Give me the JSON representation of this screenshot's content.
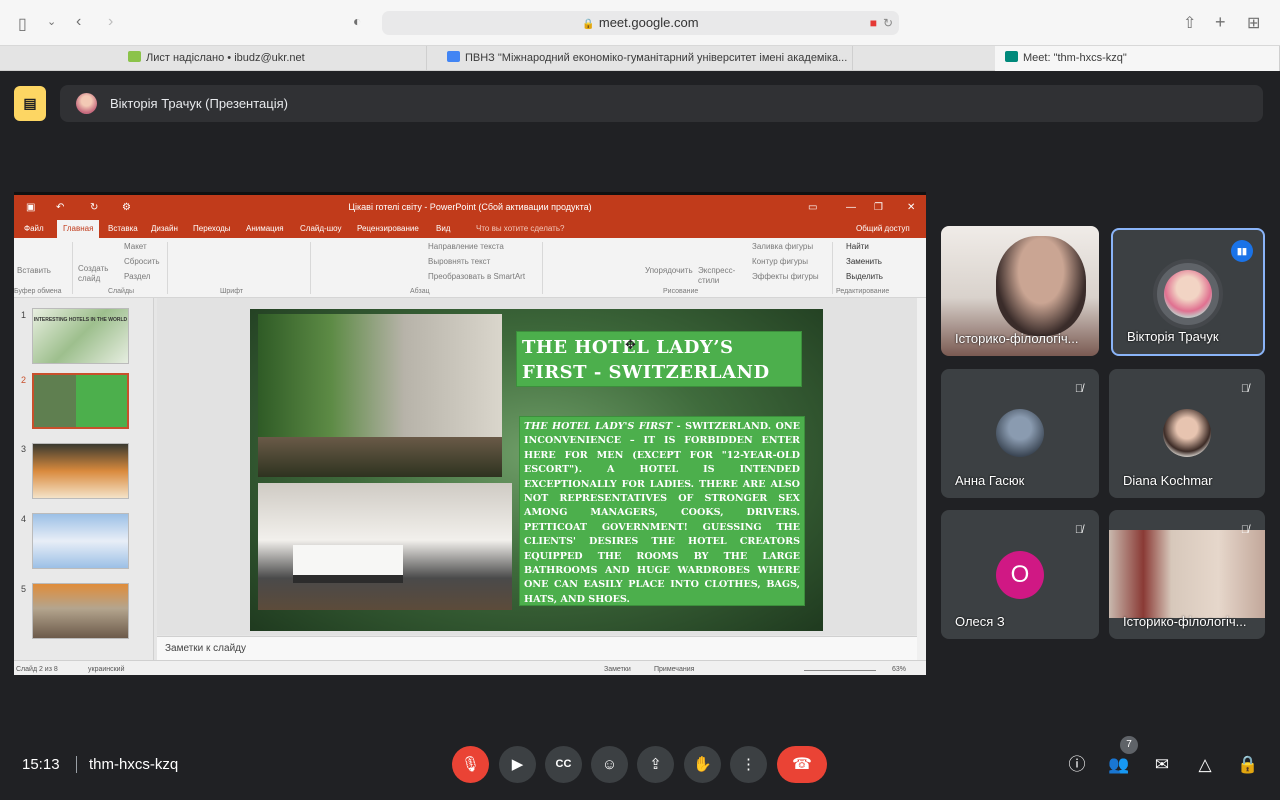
{
  "browser": {
    "url": "meet.google.com",
    "tabs": [
      {
        "title": "Лист надіслано • ibudz@ukr.net",
        "icon": "mail-icon"
      },
      {
        "title": "ПВНЗ \"Міжнародний економіко-гуманітарний університет імені академіка...",
        "icon": "calendar-icon"
      },
      {
        "title": "Meet: \"thm-hxcs-kzq\"",
        "icon": "meet-icon"
      }
    ]
  },
  "banner": {
    "presenter": "Вікторія Трачук (Презентація)"
  },
  "powerpoint": {
    "window_title": "Цікаві готелі світу - PowerPoint (Сбой активации продукта)",
    "menu": [
      "Файл",
      "Главная",
      "Вставка",
      "Дизайн",
      "Переходы",
      "Анимация",
      "Слайд-шоу",
      "Рецензирование",
      "Вид",
      "Что вы хотите сделать?",
      "Общий доступ"
    ],
    "ribbon": {
      "paste": "Вставить",
      "clipboard_group": "Буфер обмена",
      "new_slide": "Создать слайд",
      "layout": "Макет",
      "reset": "Сбросить",
      "section": "Раздел",
      "slides_group": "Слайды",
      "font_group": "Шрифт",
      "text_direction": "Направление текста",
      "align_text": "Выровнять текст",
      "smartart": "Преобразовать в SmartArt",
      "paragraph_group": "Абзац",
      "arrange": "Упорядочить",
      "quick_styles": "Экспресс-стили",
      "shape_fill": "Заливка фигуры",
      "shape_outline": "Контур фигуры",
      "shape_effects": "Эффекты фигуры",
      "drawing_group": "Рисование",
      "find": "Найти",
      "replace": "Заменить",
      "select": "Выделить",
      "editing_group": "Редактирование"
    },
    "thumbnails": [
      "1",
      "2",
      "3",
      "4",
      "5"
    ],
    "thumb1_title": "INTERESTING HOTELS IN THE WORLD",
    "notes_placeholder": "Заметки к слайду",
    "status": {
      "slide": "Слайд 2 из 8",
      "language": "украинский",
      "notes": "Заметки",
      "comments": "Примечания",
      "zoom": "63%"
    },
    "slide": {
      "title": "THE HOTEL LADY’S FIRST - SWITZERLAND",
      "body_highlight": "THE HOTEL LADY'S FIRST",
      "body": " - SWITZERLAND. ONE INCONVENIENCE – IT IS FORBIDDEN ENTER HERE FOR MEN (EXCEPT FOR \"12-YEAR-OLD ESCORT\"). A HOTEL IS INTENDED EXCEPTIONALLY FOR LADIES. THERE ARE ALSO NOT REPRESENTATIVES OF STRONGER SEX AMONG MANAGERS, COOKS, DRIVERS. PETTICOAT GOVERNMENT! GUESSING THE CLIENTS' DESIRES THE HOTEL CREATORS EQUIPPED THE ROOMS BY THE LARGE BATHROOMS AND HUGE WARDROBES WHERE ONE CAN EASILY PLACE INTO CLOTHES, BAGS, HATS, AND SHOES."
    }
  },
  "participants": [
    {
      "name": "Історико-філологіч...",
      "video": true
    },
    {
      "name": "Вікторія Трачук",
      "speaking": true
    },
    {
      "name": "Анна Гасюк",
      "muted": true
    },
    {
      "name": "Diana Kochmar",
      "muted": true
    },
    {
      "name": "Олеся З",
      "initial": "О",
      "muted": true,
      "color": "#d01884"
    },
    {
      "name": "Історико-філологіч...",
      "video": true,
      "muted": true
    }
  ],
  "bottom": {
    "time": "15:13",
    "meeting_code": "thm-hxcs-kzq",
    "participant_count": "7"
  }
}
